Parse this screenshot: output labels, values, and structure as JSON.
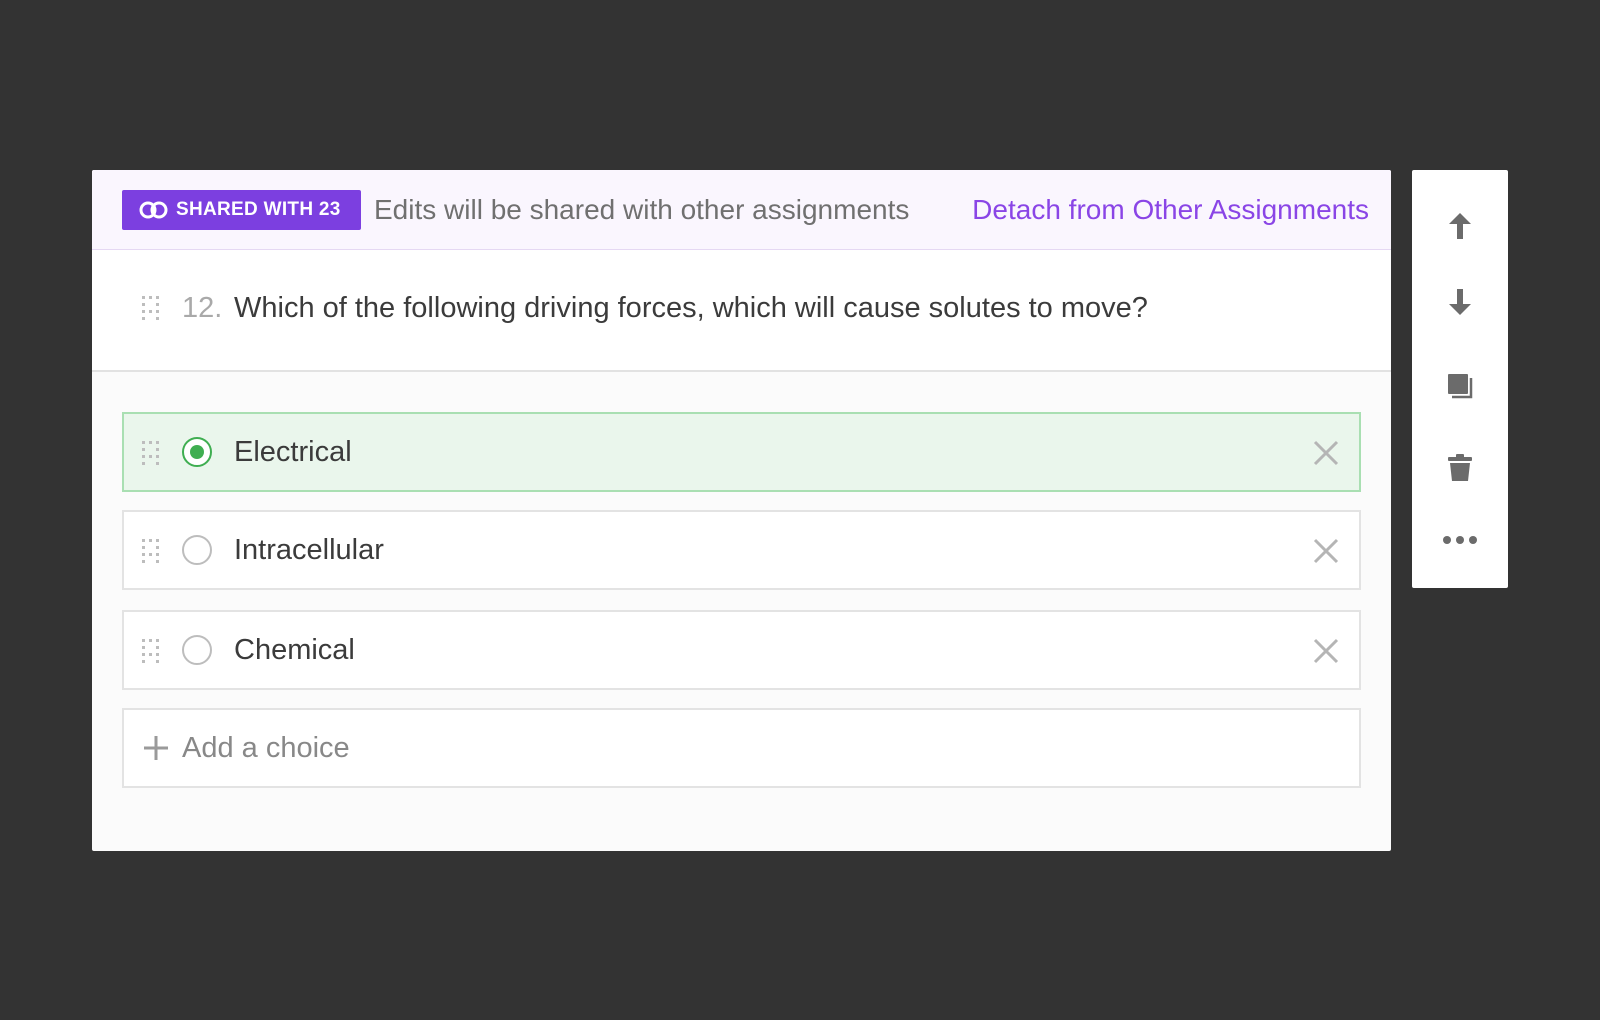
{
  "banner": {
    "badge_label": "SHARED WITH 23",
    "message": "Edits will be shared with other assignments",
    "detach_link": "Detach from Other Assignments",
    "accent_color": "#7c3fe0"
  },
  "question": {
    "number": "12.",
    "text": "Which of the following driving forces, which will cause solutes to move?"
  },
  "choices": [
    {
      "label": "Electrical",
      "selected": true
    },
    {
      "label": "Intracellular",
      "selected": false
    },
    {
      "label": "Chemical",
      "selected": false
    }
  ],
  "add_choice": {
    "label": "Add a choice"
  },
  "toolbar": {
    "icons": [
      "arrow-up-icon",
      "arrow-down-icon",
      "duplicate-icon",
      "trash-icon",
      "more-icon"
    ]
  },
  "colors": {
    "correct": "#3fae51",
    "link": "#8a45e6"
  }
}
